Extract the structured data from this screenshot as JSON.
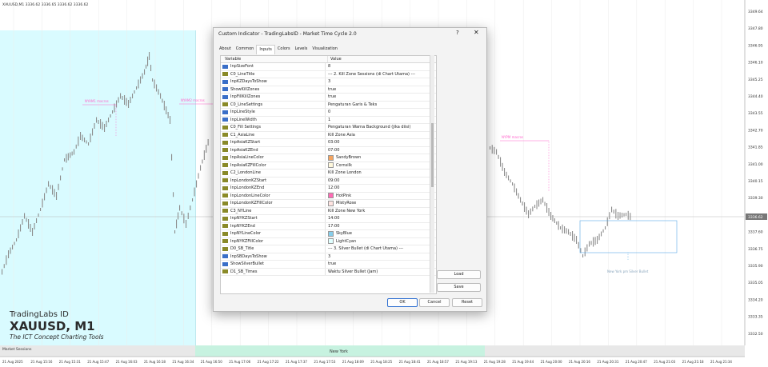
{
  "chart_header": "XAUUSD,M1  3336.62 3336.65 3336.62 3336.62",
  "price_labels": [
    "3349.64",
    "3347.80",
    "3346.95",
    "3346.10",
    "3345.25",
    "3344.40",
    "3343.55",
    "3342.70",
    "3341.85",
    "3341.00",
    "3340.15",
    "3339.30",
    "3338.45",
    "3337.60",
    "3336.75",
    "3335.90",
    "3335.05",
    "3334.20",
    "3333.35",
    "3332.50"
  ],
  "current_price": "3336.62",
  "time_labels": [
    "21 Aug 2025",
    "21 Aug 15:16",
    "21 Aug 15:31",
    "21 Aug 15:47",
    "21 Aug 16:03",
    "21 Aug 16:18",
    "21 Aug 16:34",
    "21 Aug 16:50",
    "21 Aug 17:06",
    "21 Aug 17:22",
    "21 Aug 17:37",
    "21 Aug 17:53",
    "21 Aug 18:09",
    "21 Aug 18:25",
    "21 Aug 18:41",
    "21 Aug 18:57",
    "21 Aug 19:13",
    "21 Aug 19:28",
    "21 Aug 19:44",
    "21 Aug 20:00",
    "21 Aug 20:16",
    "21 Aug 20:31",
    "21 Aug 20:47",
    "21 Aug 21:03",
    "21 Aug 21:18",
    "21 Aug 21:34"
  ],
  "markers": {
    "nyam": "NYAM1 macros",
    "nyam2": "NYAM2 macros",
    "nypm": "NYPM macros",
    "silver_bullet": "New York pm Silver Bullet"
  },
  "branding": {
    "brand": "TradingLabs ID",
    "symbol": "XAUUSD, M1",
    "tagline": "The ICT Concept Charting Tools"
  },
  "sessions": {
    "label": "Market Sessions",
    "new_york": "New York"
  },
  "colors": {
    "asia_fill": "#d9fbff",
    "ny_bar": "#c7f2e0",
    "macro_line": "#ff66cc",
    "sb_box": "#5aa9e6"
  },
  "dialog": {
    "title": "Custom Indicator - TradingLabsID - Market Time Cycle 2.0",
    "help": "?",
    "close": "✕",
    "tabs": [
      "About",
      "Common",
      "Inputs",
      "Colors",
      "Levels",
      "Visualization"
    ],
    "active_tab": 2,
    "columns": {
      "variable": "Variable",
      "value": "Value"
    },
    "rows": [
      {
        "v": "InpSizeFont",
        "val": "8",
        "t": "123"
      },
      {
        "v": "C0_LineTitle",
        "val": "--- 2. Kill Zone Sessions (di Chart Utama) ---",
        "t": "ab"
      },
      {
        "v": "InpKZDaysToShow",
        "val": "3",
        "t": "123"
      },
      {
        "v": "ShowKillZones",
        "val": "true",
        "t": "bool"
      },
      {
        "v": "InpFillKillZones",
        "val": "true",
        "t": "bool"
      },
      {
        "v": "C0_LineSettings",
        "val": "Pengaturan Garis & Teks",
        "t": "ab"
      },
      {
        "v": "InpLineStyle",
        "val": "0",
        "t": "123"
      },
      {
        "v": "InpLineWidth",
        "val": "1",
        "t": "123"
      },
      {
        "v": "C0_Fill Settings",
        "val": "Pengaturan Warna Background (jika diisi)",
        "t": "ab"
      },
      {
        "v": "C1_AsiaLine",
        "val": "Kill Zone Asia",
        "t": "ab"
      },
      {
        "v": "InpAsiaKZStart",
        "val": "03:00",
        "t": "ab"
      },
      {
        "v": "InpAsiaKZEnd",
        "val": "07:00",
        "t": "ab"
      },
      {
        "v": "InpAsiaLineColor",
        "val": "SandyBrown",
        "t": "color",
        "c": "#f4a460"
      },
      {
        "v": "InpAsiaKZFillColor",
        "val": "Cornsilk",
        "t": "color",
        "c": "#fff8dc"
      },
      {
        "v": "C2_LondonLine",
        "val": "Kill Zone London",
        "t": "ab"
      },
      {
        "v": "InpLondonKZStart",
        "val": "09:00",
        "t": "ab"
      },
      {
        "v": "InpLondonKZEnd",
        "val": "12:00",
        "t": "ab"
      },
      {
        "v": "InpLondonLineColor",
        "val": "HotPink",
        "t": "color",
        "c": "#ff69b4"
      },
      {
        "v": "InpLondonKZFillColor",
        "val": "MistyRose",
        "t": "color",
        "c": "#ffe4e1"
      },
      {
        "v": "C3_NYLine",
        "val": "Kill Zone New York",
        "t": "ab"
      },
      {
        "v": "InpNYKZStart",
        "val": "14:00",
        "t": "ab"
      },
      {
        "v": "InpNYKZEnd",
        "val": "17:00",
        "t": "ab"
      },
      {
        "v": "InpNYLineColor",
        "val": "SkyBlue",
        "t": "color",
        "c": "#87ceeb"
      },
      {
        "v": "InpNYKZFillColor",
        "val": "LightCyan",
        "t": "color",
        "c": "#e0ffff"
      },
      {
        "v": "D0_SB_Title",
        "val": "--- 3. Silver Bullet (di Chart Utama) ---",
        "t": "ab"
      },
      {
        "v": "InpSBDaysToShow",
        "val": "3",
        "t": "123"
      },
      {
        "v": "ShowSilverBullet",
        "val": "true",
        "t": "bool"
      },
      {
        "v": "D1_SB_Times",
        "val": "Waktu Silver Bullet (Jam)",
        "t": "ab"
      }
    ],
    "buttons": {
      "load": "Load",
      "save": "Save",
      "ok": "OK",
      "cancel": "Cancel",
      "reset": "Reset"
    }
  }
}
